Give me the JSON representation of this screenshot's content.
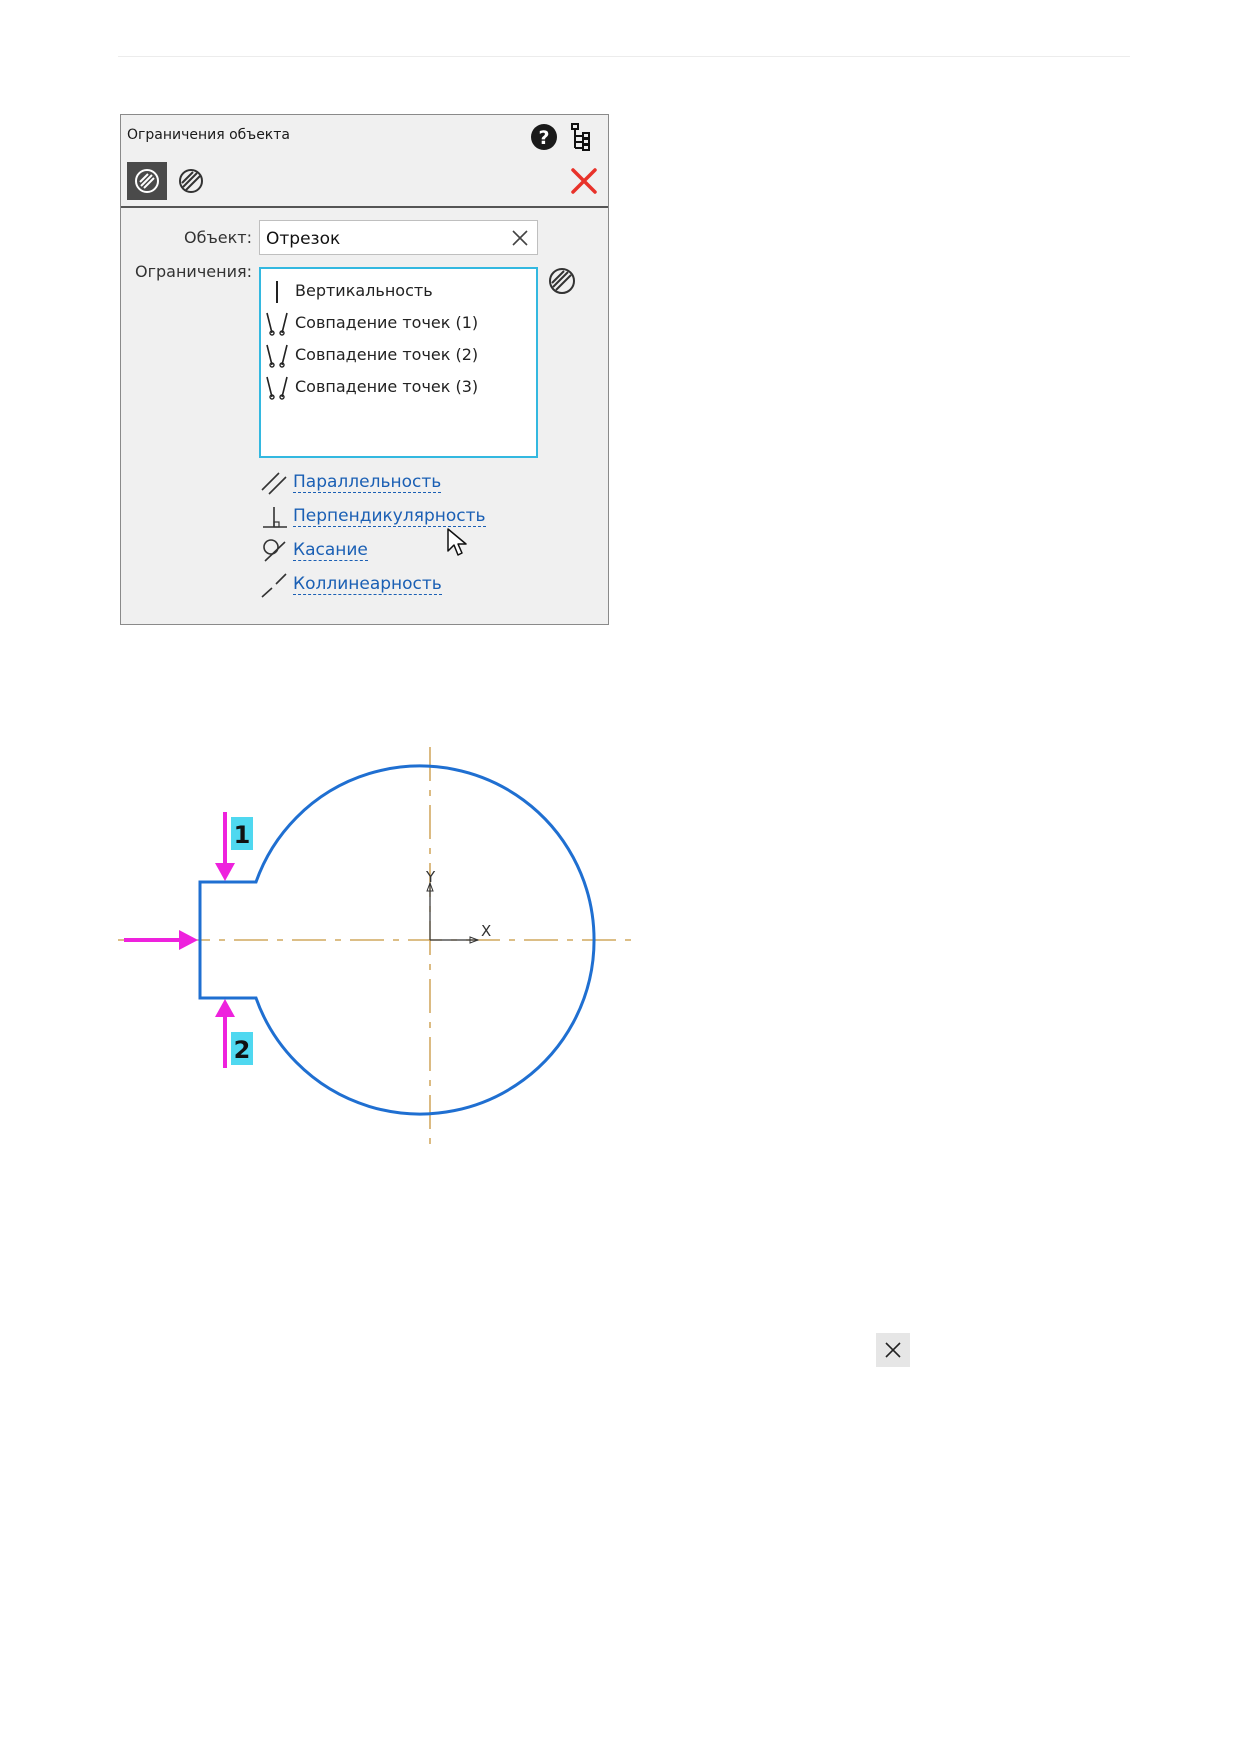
{
  "dialog": {
    "title": "Ограничения объекта",
    "help_icon": "question-circle-icon",
    "tree_icon": "tree-structure-icon",
    "close_icon": "red-x-close-icon",
    "object_label": "Объект:",
    "object_value": "Отрезок",
    "constraints_label": "Ограничения:",
    "constraints": [
      {
        "label": "Вертикальность",
        "icon": "vertical-constraint-icon"
      },
      {
        "label": "Совпадение точек (1)",
        "icon": "coincident-points-icon"
      },
      {
        "label": "Совпадение точек (2)",
        "icon": "coincident-points-icon"
      },
      {
        "label": "Совпадение точек (3)",
        "icon": "coincident-points-icon"
      }
    ],
    "add_links": [
      {
        "label": "Параллельность",
        "icon": "parallel-icon"
      },
      {
        "label": "Перпендикулярность",
        "icon": "perpendicular-icon"
      },
      {
        "label": "Касание",
        "icon": "tangent-icon"
      },
      {
        "label": "Коллинеарность",
        "icon": "collinear-icon"
      }
    ],
    "colors": {
      "list_border": "#33b8e0",
      "link": "#1a5fb4",
      "close": "#e8322a"
    }
  },
  "drawing": {
    "markers": [
      "1",
      "2"
    ],
    "axis_x": "X",
    "axis_y": "Y",
    "colors": {
      "contour": "#1f6fd1",
      "centerline": "#c8963e",
      "arrow": "#ee22dd",
      "marker_bg": "#4fd8f0"
    }
  }
}
